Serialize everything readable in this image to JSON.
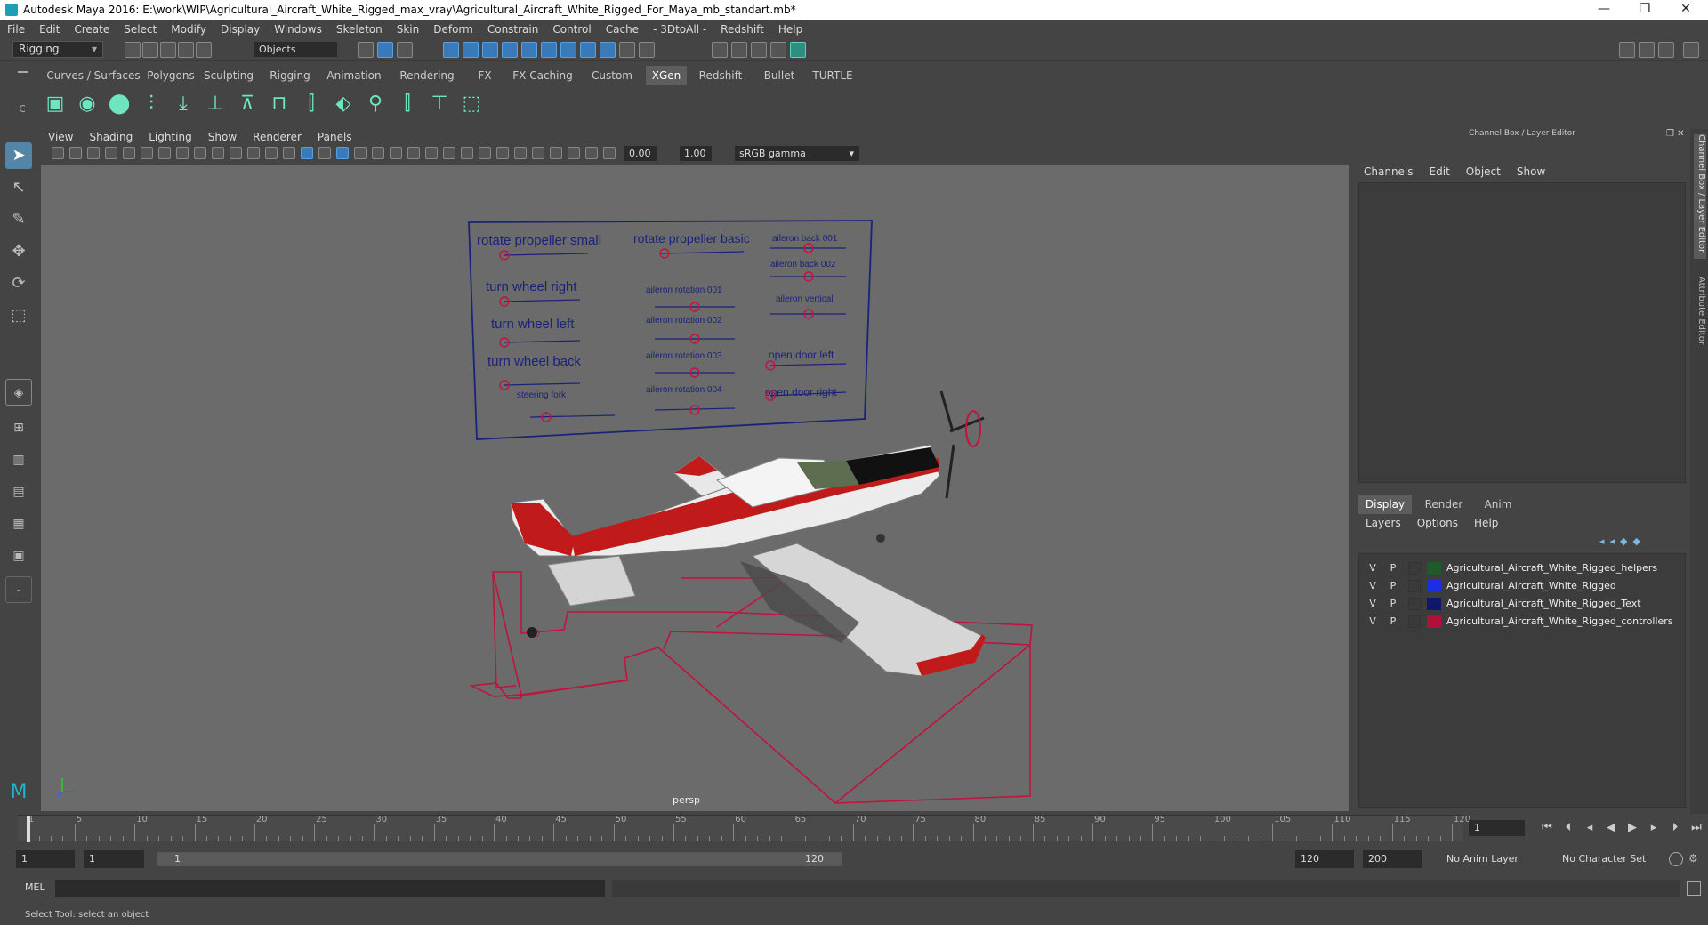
{
  "window": {
    "title": "Autodesk Maya 2016: E:\\work\\WIP\\Agricultural_Aircraft_White_Rigged_max_vray\\Agricultural_Aircraft_White_Rigged_For_Maya_mb_standart.mb*",
    "minimize": "—",
    "restore": "❐",
    "close": "✕"
  },
  "menu": [
    "File",
    "Edit",
    "Create",
    "Select",
    "Modify",
    "Display",
    "Windows",
    "Skeleton",
    "Skin",
    "Deform",
    "Constrain",
    "Control",
    "Cache",
    "- 3DtoAll -",
    "Redshift",
    "Help"
  ],
  "status": {
    "mode": "Rigging",
    "objects_field": "Objects"
  },
  "shelf_tabs": [
    "Curves / Surfaces",
    "Polygons",
    "Sculpting",
    "Rigging",
    "Animation",
    "Rendering",
    "FX",
    "FX Caching",
    "Custom",
    "XGen",
    "Redshift",
    "Bullet",
    "TURTLE"
  ],
  "shelf_active": "XGen",
  "viewport": {
    "menu": [
      "View",
      "Shading",
      "Lighting",
      "Show",
      "Renderer",
      "Panels"
    ],
    "exposure": "0.00",
    "gamma": "1.00",
    "colorspace": "sRGB gamma",
    "camera": "persp",
    "rig_panel": {
      "labels": [
        "rotate propeller small",
        "rotate propeller basic",
        "aileron back 001",
        "aileron back 002",
        "turn wheel right",
        "aileron rotation 001",
        "aileron vertical",
        "turn wheel left",
        "aileron rotation 002",
        "turn wheel back",
        "aileron rotation 003",
        "open door left",
        "steering fork",
        "aileron rotation 004",
        "open door right"
      ]
    }
  },
  "channel_box": {
    "header": "Channel Box / Layer Editor",
    "menu": [
      "Channels",
      "Edit",
      "Object",
      "Show"
    ]
  },
  "layer_editor": {
    "tabs": [
      "Display",
      "Render",
      "Anim"
    ],
    "active_tab": "Display",
    "menu": [
      "Layers",
      "Options",
      "Help"
    ],
    "layers": [
      {
        "v": "V",
        "p": "P",
        "name": "Agricultural_Aircraft_White_Rigged_helpers",
        "color": "#1e5a2a"
      },
      {
        "v": "V",
        "p": "P",
        "name": "Agricultural_Aircraft_White_Rigged",
        "color": "#1a2de0"
      },
      {
        "v": "V",
        "p": "P",
        "name": "Agricultural_Aircraft_White_Rigged_Text",
        "color": "#10186e"
      },
      {
        "v": "V",
        "p": "P",
        "name": "Agricultural_Aircraft_White_Rigged_controllers",
        "color": "#b0103a"
      }
    ]
  },
  "side_tabs": [
    "Channel Box / Layer Editor",
    "Attribute Editor"
  ],
  "timeline": {
    "ticks": [
      "1",
      "5",
      "10",
      "15",
      "20",
      "25",
      "30",
      "35",
      "40",
      "45",
      "50",
      "55",
      "60",
      "65",
      "70",
      "75",
      "80",
      "85",
      "90",
      "95",
      "100",
      "105",
      "110",
      "115",
      "120"
    ],
    "current_frame": "1"
  },
  "range": {
    "start": "1",
    "playback_start": "1",
    "slider_start": "1",
    "slider_end": "120",
    "playback_end": "120",
    "end": "200",
    "anim_layer": "No Anim Layer",
    "character_set": "No Character Set"
  },
  "command": {
    "label": "MEL"
  },
  "help_line": "Select Tool: select an object"
}
